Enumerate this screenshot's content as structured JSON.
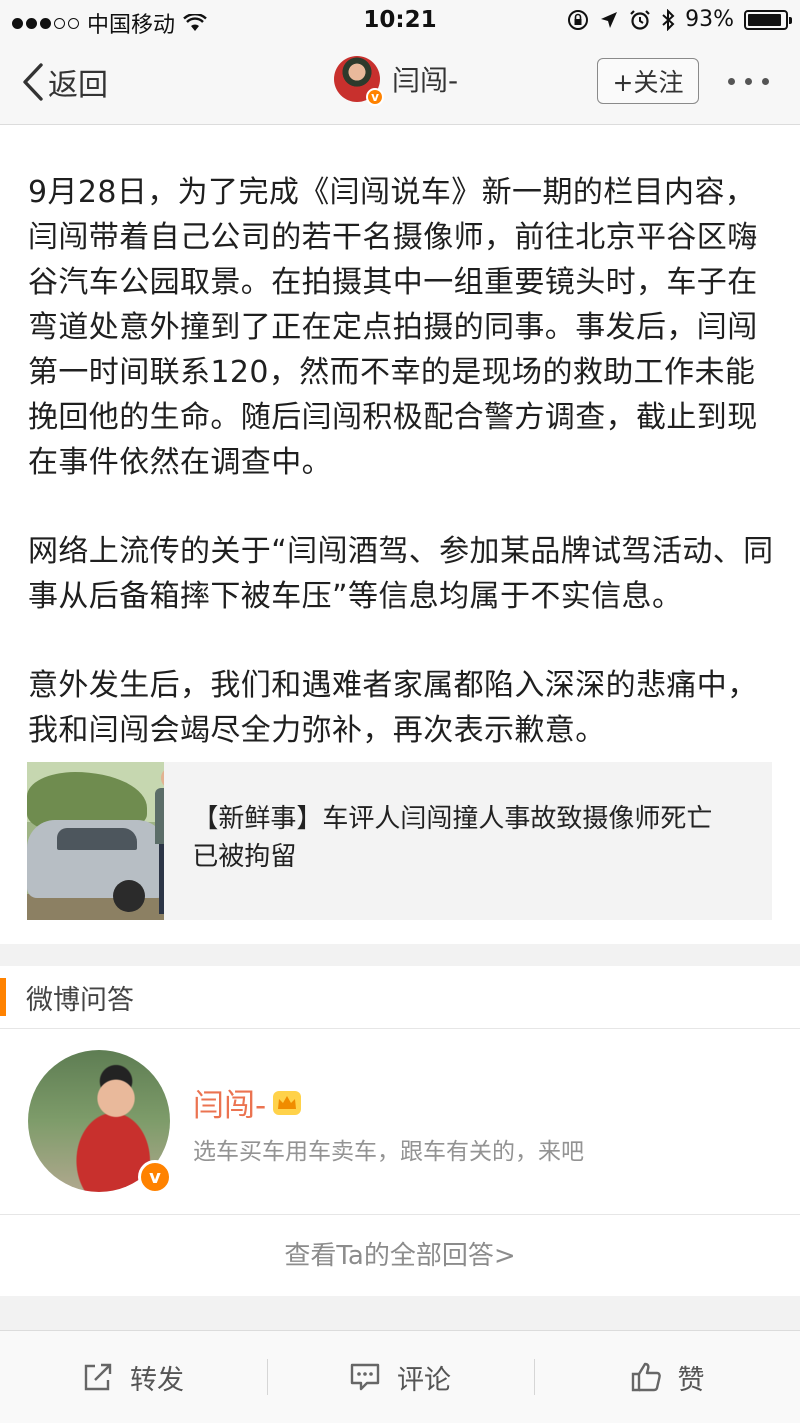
{
  "status_bar": {
    "carrier": "中国移动",
    "time": "10:21",
    "battery_percent": "93%",
    "battery_level": 0.93,
    "signal_dots_filled": 3,
    "signal_dots_total": 5
  },
  "nav": {
    "back_label": "返回",
    "user_name": "闫闯-",
    "follow_label": "+关注"
  },
  "article": {
    "paragraphs": [
      "9月28日，为了完成《闫闯说车》新一期的栏目内容，闫闯带着自己公司的若干名摄像师，前往北京平谷区嗨谷汽车公园取景。在拍摄其中一组重要镜头时，车子在弯道处意外撞到了正在定点拍摄的同事。事发后，闫闯第一时间联系120，然而不幸的是现场的救助工作未能挽回他的生命。随后闫闯积极配合警方调查，截止到现在事件依然在调查中。",
      "网络上流传的关于“闫闯酒驾、参加某品牌试驾活动、同事从后备箱摔下被车压”等信息均属于不实信息。",
      "意外发生后，我们和遇难者家属都陷入深深的悲痛中，我和闫闯会竭尽全力弥补，再次表示歉意。"
    ]
  },
  "link_card": {
    "text": "【新鲜事】车评人闫闯撞人事故致摄像师死亡 已被拘留"
  },
  "qa_section": {
    "title": "微博问答",
    "user_name": "闫闯-",
    "description": "选车买车用车卖车，跟车有关的，来吧",
    "view_all": "查看Ta的全部回答>"
  },
  "bottom_bar": {
    "repost": "转发",
    "comment": "评论",
    "like": "赞"
  },
  "colors": {
    "accent_orange": "#ff8200",
    "name_orange": "#eb7350"
  },
  "icons": [
    "wifi-icon",
    "lock-rotation-icon",
    "location-arrow-icon",
    "alarm-icon",
    "bluetooth-icon",
    "battery-icon",
    "back-chevron-icon",
    "verified-badge-icon",
    "more-dots-icon",
    "crown-icon",
    "repost-icon",
    "comment-icon",
    "like-icon"
  ]
}
